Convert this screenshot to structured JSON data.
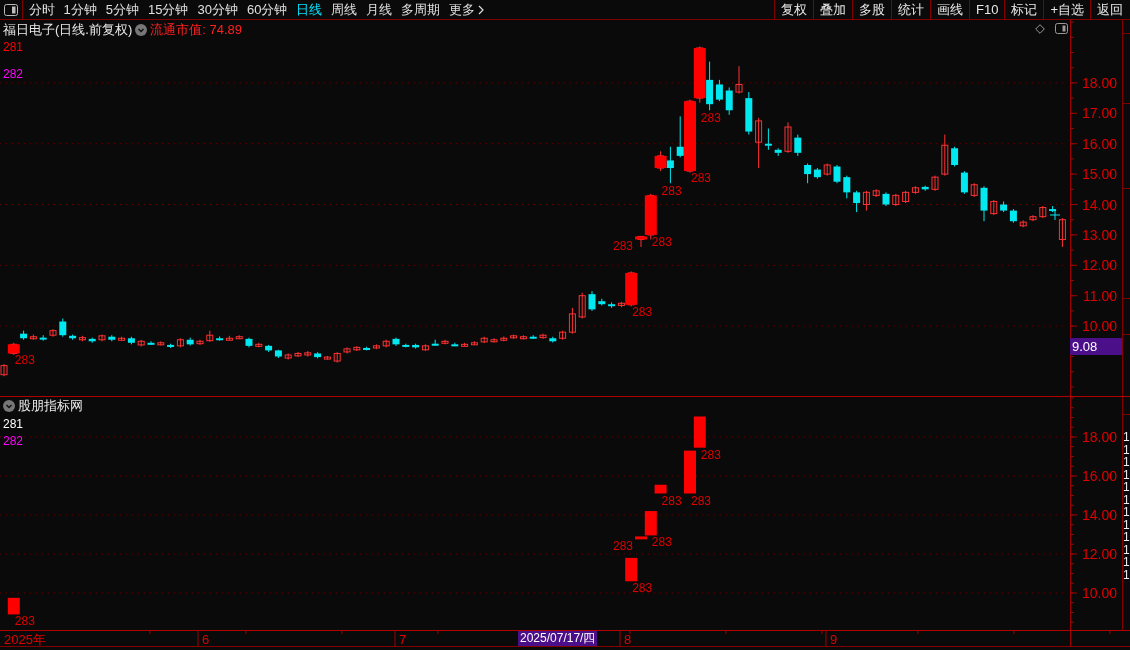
{
  "toolbar": {
    "tabs": [
      {
        "label": "分时",
        "selected": false
      },
      {
        "label": "1分钟",
        "selected": false
      },
      {
        "label": "5分钟",
        "selected": false
      },
      {
        "label": "15分钟",
        "selected": false
      },
      {
        "label": "30分钟",
        "selected": false
      },
      {
        "label": "60分钟",
        "selected": false
      },
      {
        "label": "日线",
        "selected": true
      },
      {
        "label": "周线",
        "selected": false
      },
      {
        "label": "月线",
        "selected": false
      },
      {
        "label": "多周期",
        "selected": false
      },
      {
        "label": "更多",
        "selected": false
      }
    ],
    "buttons": [
      "复权",
      "叠加",
      "多股",
      "统计",
      "画线",
      "F10",
      "标记",
      "+自选",
      "返回"
    ]
  },
  "price_chart": {
    "title": "福日电子(日线.前复权)",
    "market_cap": "流通市值: 74.89",
    "legend": [
      {
        "label": "281",
        "color": "#ff0000"
      },
      {
        "label": "282",
        "color": "#ff00ff"
      }
    ],
    "chart_data": {
      "type": "candlestick",
      "ylim": [
        7.7,
        20.07
      ],
      "grid": true,
      "yticks": [
        {
          "value": 18,
          "label": "18.00"
        },
        {
          "value": 17,
          "label": "17.00"
        },
        {
          "value": 16,
          "label": "16.00"
        },
        {
          "value": 15,
          "label": "15.00"
        },
        {
          "value": 14,
          "label": "14.00"
        },
        {
          "value": 13,
          "label": "13.00"
        },
        {
          "value": 12,
          "label": "12.00"
        },
        {
          "value": 11,
          "label": "11.00"
        },
        {
          "value": 10,
          "label": "10.00"
        }
      ],
      "ohlc": [
        [
          8.4,
          8.75,
          8.35,
          8.7
        ],
        [
          9.1,
          9.45,
          9.05,
          9.4
        ],
        [
          9.75,
          9.85,
          9.55,
          9.6
        ],
        [
          9.6,
          9.72,
          9.55,
          9.65
        ],
        [
          9.62,
          9.7,
          9.52,
          9.6
        ],
        [
          9.7,
          9.9,
          9.65,
          9.85
        ],
        [
          10.15,
          10.25,
          9.65,
          9.7
        ],
        [
          9.68,
          9.72,
          9.55,
          9.6
        ],
        [
          9.55,
          9.68,
          9.5,
          9.62
        ],
        [
          9.58,
          9.62,
          9.45,
          9.5
        ],
        [
          9.55,
          9.72,
          9.5,
          9.68
        ],
        [
          9.65,
          9.7,
          9.5,
          9.55
        ],
        [
          9.58,
          9.65,
          9.52,
          9.6
        ],
        [
          9.6,
          9.65,
          9.4,
          9.45
        ],
        [
          9.38,
          9.55,
          9.33,
          9.5
        ],
        [
          9.45,
          9.5,
          9.38,
          9.42
        ],
        [
          9.4,
          9.5,
          9.36,
          9.45
        ],
        [
          9.38,
          9.42,
          9.28,
          9.32
        ],
        [
          9.35,
          9.6,
          9.3,
          9.55
        ],
        [
          9.55,
          9.62,
          9.36,
          9.4
        ],
        [
          9.42,
          9.55,
          9.38,
          9.5
        ],
        [
          9.52,
          9.85,
          9.48,
          9.7
        ],
        [
          9.6,
          9.66,
          9.52,
          9.58
        ],
        [
          9.58,
          9.68,
          9.54,
          9.6
        ],
        [
          9.62,
          9.7,
          9.58,
          9.65
        ],
        [
          9.58,
          9.62,
          9.3,
          9.35
        ],
        [
          9.35,
          9.45,
          9.3,
          9.4
        ],
        [
          9.35,
          9.38,
          9.15,
          9.2
        ],
        [
          9.2,
          9.22,
          8.95,
          9.0
        ],
        [
          8.95,
          9.1,
          8.9,
          9.05
        ],
        [
          9.02,
          9.15,
          8.98,
          9.1
        ],
        [
          9.05,
          9.18,
          9.0,
          9.12
        ],
        [
          9.1,
          9.14,
          8.94,
          8.98
        ],
        [
          8.95,
          9.02,
          8.9,
          8.98
        ],
        [
          8.85,
          9.14,
          8.8,
          9.1
        ],
        [
          9.15,
          9.3,
          9.1,
          9.25
        ],
        [
          9.22,
          9.34,
          9.18,
          9.3
        ],
        [
          9.28,
          9.32,
          9.2,
          9.25
        ],
        [
          9.28,
          9.4,
          9.24,
          9.35
        ],
        [
          9.35,
          9.55,
          9.3,
          9.5
        ],
        [
          9.58,
          9.62,
          9.35,
          9.4
        ],
        [
          9.38,
          9.42,
          9.3,
          9.35
        ],
        [
          9.38,
          9.42,
          9.26,
          9.3
        ],
        [
          9.22,
          9.4,
          9.18,
          9.35
        ],
        [
          9.42,
          9.55,
          9.36,
          9.4
        ],
        [
          9.45,
          9.55,
          9.4,
          9.5
        ],
        [
          9.4,
          9.45,
          9.34,
          9.38
        ],
        [
          9.38,
          9.45,
          9.34,
          9.4
        ],
        [
          9.42,
          9.5,
          9.38,
          9.45
        ],
        [
          9.48,
          9.65,
          9.44,
          9.6
        ],
        [
          9.5,
          9.6,
          9.46,
          9.55
        ],
        [
          9.55,
          9.66,
          9.5,
          9.6
        ],
        [
          9.62,
          9.72,
          9.58,
          9.68
        ],
        [
          9.6,
          9.7,
          9.56,
          9.65
        ],
        [
          9.65,
          9.7,
          9.58,
          9.62
        ],
        [
          9.62,
          9.75,
          9.58,
          9.7
        ],
        [
          9.6,
          9.65,
          9.46,
          9.5
        ],
        [
          9.6,
          9.85,
          9.55,
          9.8
        ],
        [
          9.8,
          10.6,
          9.75,
          10.4
        ],
        [
          10.3,
          11.1,
          10.25,
          11.0
        ],
        [
          11.05,
          11.15,
          10.5,
          10.55
        ],
        [
          10.82,
          10.9,
          10.68,
          10.72
        ],
        [
          10.72,
          10.78,
          10.6,
          10.68
        ],
        [
          10.68,
          10.8,
          10.62,
          10.75
        ],
        [
          10.7,
          11.8,
          10.65,
          11.75
        ],
        [
          12.85,
          12.95,
          12.6,
          12.95
        ],
        [
          13.0,
          14.35,
          12.85,
          14.3
        ],
        [
          15.2,
          15.75,
          15.1,
          15.6
        ],
        [
          15.45,
          15.9,
          14.7,
          15.2
        ],
        [
          15.9,
          16.9,
          15.55,
          15.6
        ],
        [
          15.1,
          17.45,
          15.05,
          17.4
        ],
        [
          17.5,
          19.2,
          17.35,
          19.15
        ],
        [
          18.1,
          18.7,
          17.1,
          17.3
        ],
        [
          17.95,
          18.1,
          17.4,
          17.45
        ],
        [
          17.75,
          17.85,
          16.95,
          17.1
        ],
        [
          17.7,
          18.55,
          17.65,
          17.95
        ],
        [
          17.5,
          17.7,
          16.3,
          16.4
        ],
        [
          16.05,
          16.85,
          15.2,
          16.75
        ],
        [
          16.0,
          16.5,
          15.8,
          15.95
        ],
        [
          15.8,
          15.85,
          15.6,
          15.7
        ],
        [
          15.75,
          16.7,
          15.7,
          16.55
        ],
        [
          16.2,
          16.3,
          15.6,
          15.7
        ],
        [
          15.3,
          15.35,
          14.7,
          15.0
        ],
        [
          15.15,
          15.2,
          14.85,
          14.9
        ],
        [
          15.0,
          15.35,
          14.95,
          15.3
        ],
        [
          15.25,
          15.3,
          14.7,
          14.75
        ],
        [
          14.9,
          14.95,
          14.2,
          14.4
        ],
        [
          14.4,
          14.45,
          13.75,
          14.05
        ],
        [
          14.0,
          14.45,
          13.8,
          14.4
        ],
        [
          14.3,
          14.5,
          14.25,
          14.45
        ],
        [
          14.35,
          14.4,
          13.95,
          14.0
        ],
        [
          14.0,
          14.35,
          13.95,
          14.3
        ],
        [
          14.1,
          14.45,
          14.05,
          14.4
        ],
        [
          14.4,
          14.6,
          14.35,
          14.55
        ],
        [
          14.58,
          14.62,
          14.45,
          14.5
        ],
        [
          14.5,
          14.95,
          14.45,
          14.9
        ],
        [
          15.0,
          16.3,
          14.95,
          15.95
        ],
        [
          15.85,
          15.9,
          15.25,
          15.3
        ],
        [
          15.05,
          15.1,
          14.35,
          14.4
        ],
        [
          14.3,
          14.7,
          14.25,
          14.65
        ],
        [
          14.55,
          14.6,
          13.45,
          13.8
        ],
        [
          13.7,
          14.15,
          13.65,
          14.1
        ],
        [
          14.0,
          14.1,
          13.75,
          13.8
        ],
        [
          13.8,
          13.85,
          13.4,
          13.45
        ],
        [
          13.3,
          13.48,
          13.25,
          13.42
        ],
        [
          13.5,
          13.65,
          13.45,
          13.6
        ],
        [
          13.6,
          13.95,
          13.55,
          13.9
        ],
        [
          13.85,
          13.95,
          13.75,
          13.8
        ],
        [
          12.85,
          13.55,
          12.6,
          13.5
        ]
      ],
      "annotations": [
        "283",
        "283",
        "283",
        "283",
        "283",
        "283",
        "283"
      ]
    }
  },
  "crosshair": {
    "price_label": "9.08",
    "date_label": "2025/07/17/四"
  },
  "indicator_panel": {
    "title": "股朋指标网",
    "legend": [
      {
        "label": "281",
        "color": "#ffffff"
      },
      {
        "label": "282",
        "color": "#ff00ff"
      }
    ],
    "chart_data": {
      "type": "candlestick",
      "ylim": [
        8.1,
        20.05
      ],
      "grid": true,
      "yticks": [
        {
          "value": 18,
          "label": "18.00"
        },
        {
          "value": 16,
          "label": "16.00"
        },
        {
          "value": 14,
          "label": "14.00"
        },
        {
          "value": 12,
          "label": "12.00"
        },
        {
          "value": 10,
          "label": "10.00"
        }
      ],
      "ohlc": [
        null,
        [
          8.9,
          9.75,
          8.9,
          9.75
        ],
        null,
        null,
        null,
        null,
        null,
        null,
        null,
        null,
        null,
        null,
        null,
        null,
        null,
        null,
        null,
        null,
        null,
        null,
        null,
        null,
        null,
        null,
        null,
        null,
        null,
        null,
        null,
        null,
        null,
        null,
        null,
        null,
        null,
        null,
        null,
        null,
        null,
        null,
        null,
        null,
        null,
        null,
        null,
        null,
        null,
        null,
        null,
        null,
        null,
        null,
        null,
        null,
        null,
        null,
        null,
        null,
        null,
        null,
        null,
        null,
        null,
        null,
        [
          10.6,
          11.8,
          10.6,
          11.8
        ],
        [
          12.75,
          12.9,
          12.75,
          12.9
        ],
        [
          12.95,
          14.2,
          12.95,
          14.2
        ],
        [
          15.1,
          15.55,
          15.1,
          15.55
        ],
        null,
        null,
        [
          15.1,
          17.3,
          15.1,
          17.3
        ],
        [
          17.45,
          19.05,
          17.45,
          19.05
        ],
        null,
        null,
        null,
        null,
        null,
        null,
        null,
        null,
        null,
        null,
        null,
        null,
        null,
        null,
        null,
        null,
        null,
        null,
        null,
        null,
        null,
        null,
        null,
        null,
        null,
        null,
        null,
        null,
        null,
        null,
        null,
        null,
        null,
        null,
        null,
        null,
        null
      ],
      "annotations": [
        "283",
        "283",
        "283",
        "283",
        "283",
        "283",
        "283"
      ]
    }
  },
  "date_axis": [
    "2025年",
    "6",
    "7",
    "8",
    "9"
  ],
  "side_panel": {
    "values": [
      "1",
      "1",
      "1",
      "1",
      "1",
      "1",
      "1",
      "1",
      "1",
      "1",
      "1",
      "1"
    ]
  }
}
